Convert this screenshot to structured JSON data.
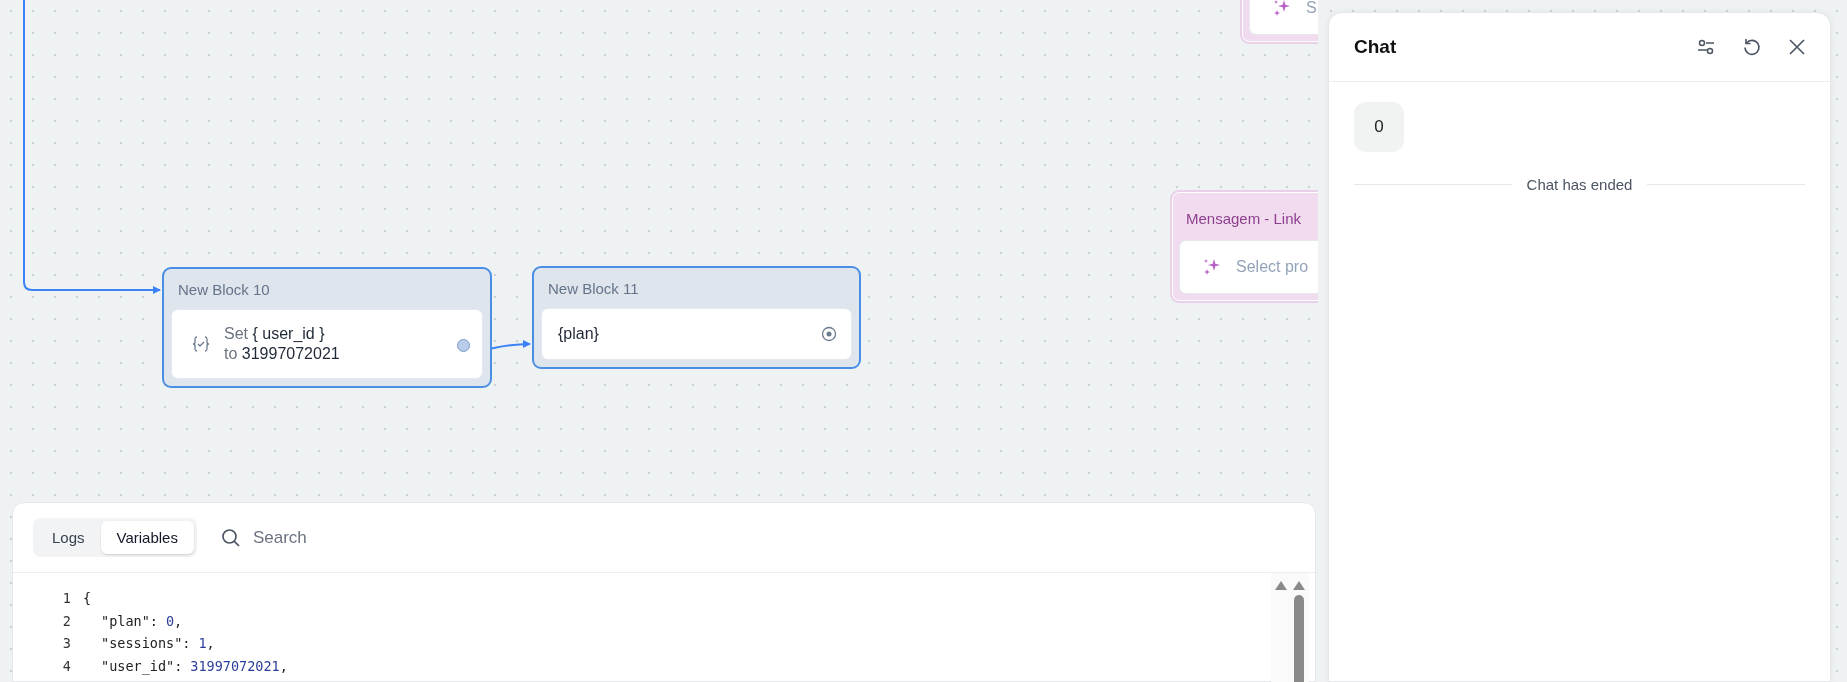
{
  "canvas": {
    "blocks": [
      {
        "kind": "set_variable",
        "title": "New Block 10",
        "selected": true,
        "set_label": "Set",
        "variable": "{ user_id }",
        "to_label": "to",
        "value": "31997072021"
      },
      {
        "kind": "text",
        "title": "New Block 11",
        "selected": true,
        "text": "{plan}"
      },
      {
        "kind": "ai_prompt",
        "prompt": "S"
      },
      {
        "kind": "ai_prompt",
        "title": "Mensagem - Link",
        "prompt": "Select pro"
      }
    ]
  },
  "debug_panel": {
    "tabs": [
      {
        "label": "Logs",
        "selected": false
      },
      {
        "label": "Variables",
        "selected": true
      }
    ],
    "search": {
      "placeholder": "Search"
    },
    "code_lines": [
      {
        "number": "1",
        "kind": "brace",
        "text": "{"
      },
      {
        "number": "2",
        "kind": "pair",
        "key": "\"plan\":",
        "value": "0",
        "punct": ","
      },
      {
        "number": "3",
        "kind": "pair",
        "key": "\"sessions\":",
        "value": "1",
        "punct": ","
      },
      {
        "number": "4",
        "kind": "pair",
        "key": "\"user_id\":",
        "value": "31997072021",
        "punct": ","
      }
    ]
  },
  "chat": {
    "title": "Chat",
    "messages": [
      {
        "text": "0"
      }
    ],
    "status": "Chat has ended"
  }
}
